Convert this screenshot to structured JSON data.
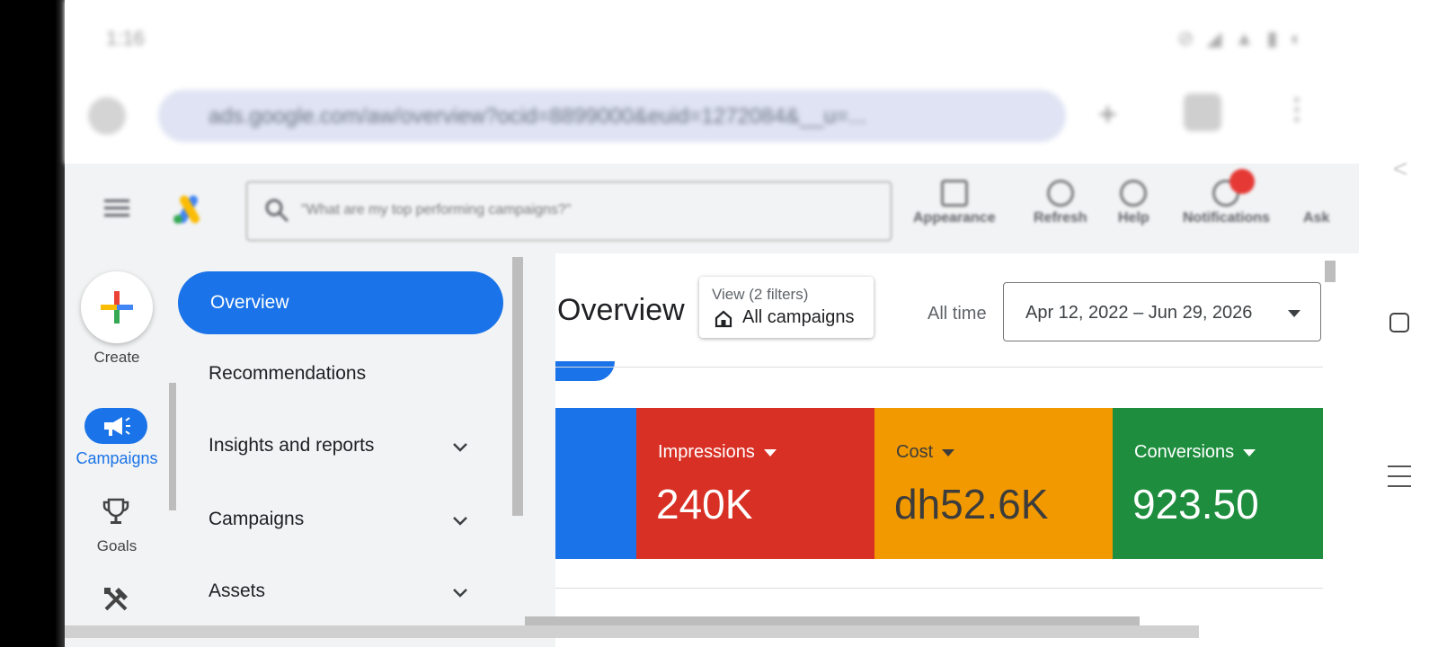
{
  "status_bar": {
    "time": "1:16",
    "icons": "⊘ ◢ ▲ ▮ ◐"
  },
  "browser": {
    "url": "ads.google.com/aw/overview?ocid=8899000&euid=1272084&__u=...",
    "new_tab_glyph": "+",
    "menu_glyph": "⋮"
  },
  "topbar": {
    "search_placeholder": "\"What are my top performing campaigns?\"",
    "tools": [
      {
        "label": "Appearance",
        "icon": "appearance-icon"
      },
      {
        "label": "Refresh",
        "icon": "refresh-icon"
      },
      {
        "label": "Help",
        "icon": "help-icon"
      },
      {
        "label": "Notifications",
        "icon": "bell-icon"
      },
      {
        "label": "Ask",
        "icon": "ask-icon"
      }
    ]
  },
  "rail": {
    "create": "Create",
    "campaigns": "Campaigns",
    "goals": "Goals"
  },
  "nav": {
    "overview": "Overview",
    "recommendations": "Recommendations",
    "insights": "Insights and reports",
    "campaigns": "Campaigns",
    "assets": "Assets"
  },
  "main": {
    "title": "Overview",
    "filter_view": "View (2 filters)",
    "filter_value": "All campaigns",
    "date_label": "All time",
    "date_range": "Apr 12, 2022 – Jun 29, 2026"
  },
  "scorecards": [
    {
      "label": "Impressions",
      "value": "240K",
      "color": "#d93025"
    },
    {
      "label": "Cost",
      "value": "dh52.6K",
      "color": "#f29900"
    },
    {
      "label": "Conversions",
      "value": "923.50",
      "color": "#1e8e3e"
    }
  ],
  "colors": {
    "accent": "#1a73e8",
    "panel": "#f1f3f4"
  }
}
